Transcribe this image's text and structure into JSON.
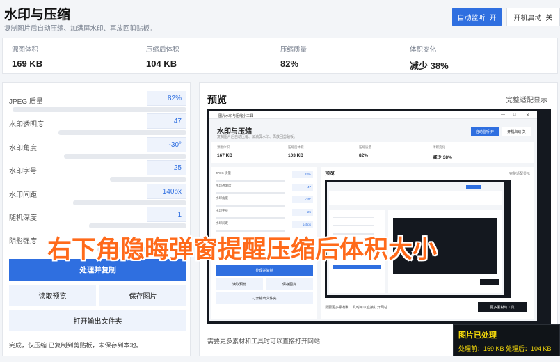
{
  "header": {
    "title": "水印与压缩",
    "subtitle": "复制图片后自动压缩、加满屏水印、再放回剪贴板。",
    "auto_monitor_label": "自动监听",
    "auto_monitor_state": "开",
    "boot_start_label": "开机启动",
    "boot_start_state": "关"
  },
  "stats": [
    {
      "label": "源图体积",
      "value": "169 KB"
    },
    {
      "label": "压缩后体积",
      "value": "104 KB"
    },
    {
      "label": "压缩质量",
      "value": "82%"
    },
    {
      "label": "体积变化",
      "value": "减少 38%"
    }
  ],
  "settings": [
    {
      "label": "JPEG 质量",
      "value": "82%",
      "slider_fraction": 0.98
    },
    {
      "label": "水印透明度",
      "value": "47",
      "slider_fraction": 0.72
    },
    {
      "label": "水印角度",
      "value": "-30°",
      "slider_fraction": 0.69
    },
    {
      "label": "水印字号",
      "value": "25",
      "slider_fraction": 0.43
    },
    {
      "label": "水印间距",
      "value": "140px",
      "slider_fraction": 0.64
    },
    {
      "label": "随机深度",
      "value": "1",
      "slider_fraction": 0.55
    },
    {
      "label": "阴影强度",
      "value": "",
      "slider_fraction": 0.5
    }
  ],
  "actions": {
    "process": "处理并复制",
    "read_preview": "读取预览",
    "save_image": "保存图片",
    "open_folder": "打开输出文件夹"
  },
  "status": "完成，仅压缩 已复制到剪贴板，未保存到本地。",
  "preview": {
    "title": "预览",
    "fit_label": "完整适配显示",
    "hint": "需要更多素材和工具时可以直接打开网站",
    "inner_window_title": "图片水印与压缩小工具",
    "inner_title": "水印与压缩",
    "inner_subtitle": "复制图片后自动压缩、加满屏水印、再放回剪贴板。",
    "inner_auto": "自动监听 开",
    "inner_boot": "开机启动 关",
    "inner_stats": [
      {
        "label": "源图体积",
        "value": "167 KB"
      },
      {
        "label": "压缩后体积",
        "value": "103 KB"
      },
      {
        "label": "压缩质量",
        "value": "82%"
      },
      {
        "label": "体积变化",
        "value": "减少 38%"
      }
    ],
    "inner_rows": [
      {
        "label": "JPEG 质量",
        "value": "82%"
      },
      {
        "label": "水印透明度",
        "value": "47"
      },
      {
        "label": "水印角度",
        "value": "-30°"
      },
      {
        "label": "水印字号",
        "value": "25"
      },
      {
        "label": "水印间距",
        "value": "140px"
      }
    ],
    "inner_process": "处理并复制",
    "inner_read": "读取预览",
    "inner_save": "保存图片",
    "inner_open": "打开输出文件夹",
    "inner_preview_title": "预览",
    "inner_fit": "完整适配显示",
    "inner_hint": "需要更多素材和工具时可以直接打开网站",
    "inner_site_btn": "更多素材与工具"
  },
  "caption": "右下角隐晦弹窗提醒压缩后体积大小",
  "toast": {
    "title": "图片已处理",
    "body": "处理前：169 KB  处理后：104 KB"
  }
}
